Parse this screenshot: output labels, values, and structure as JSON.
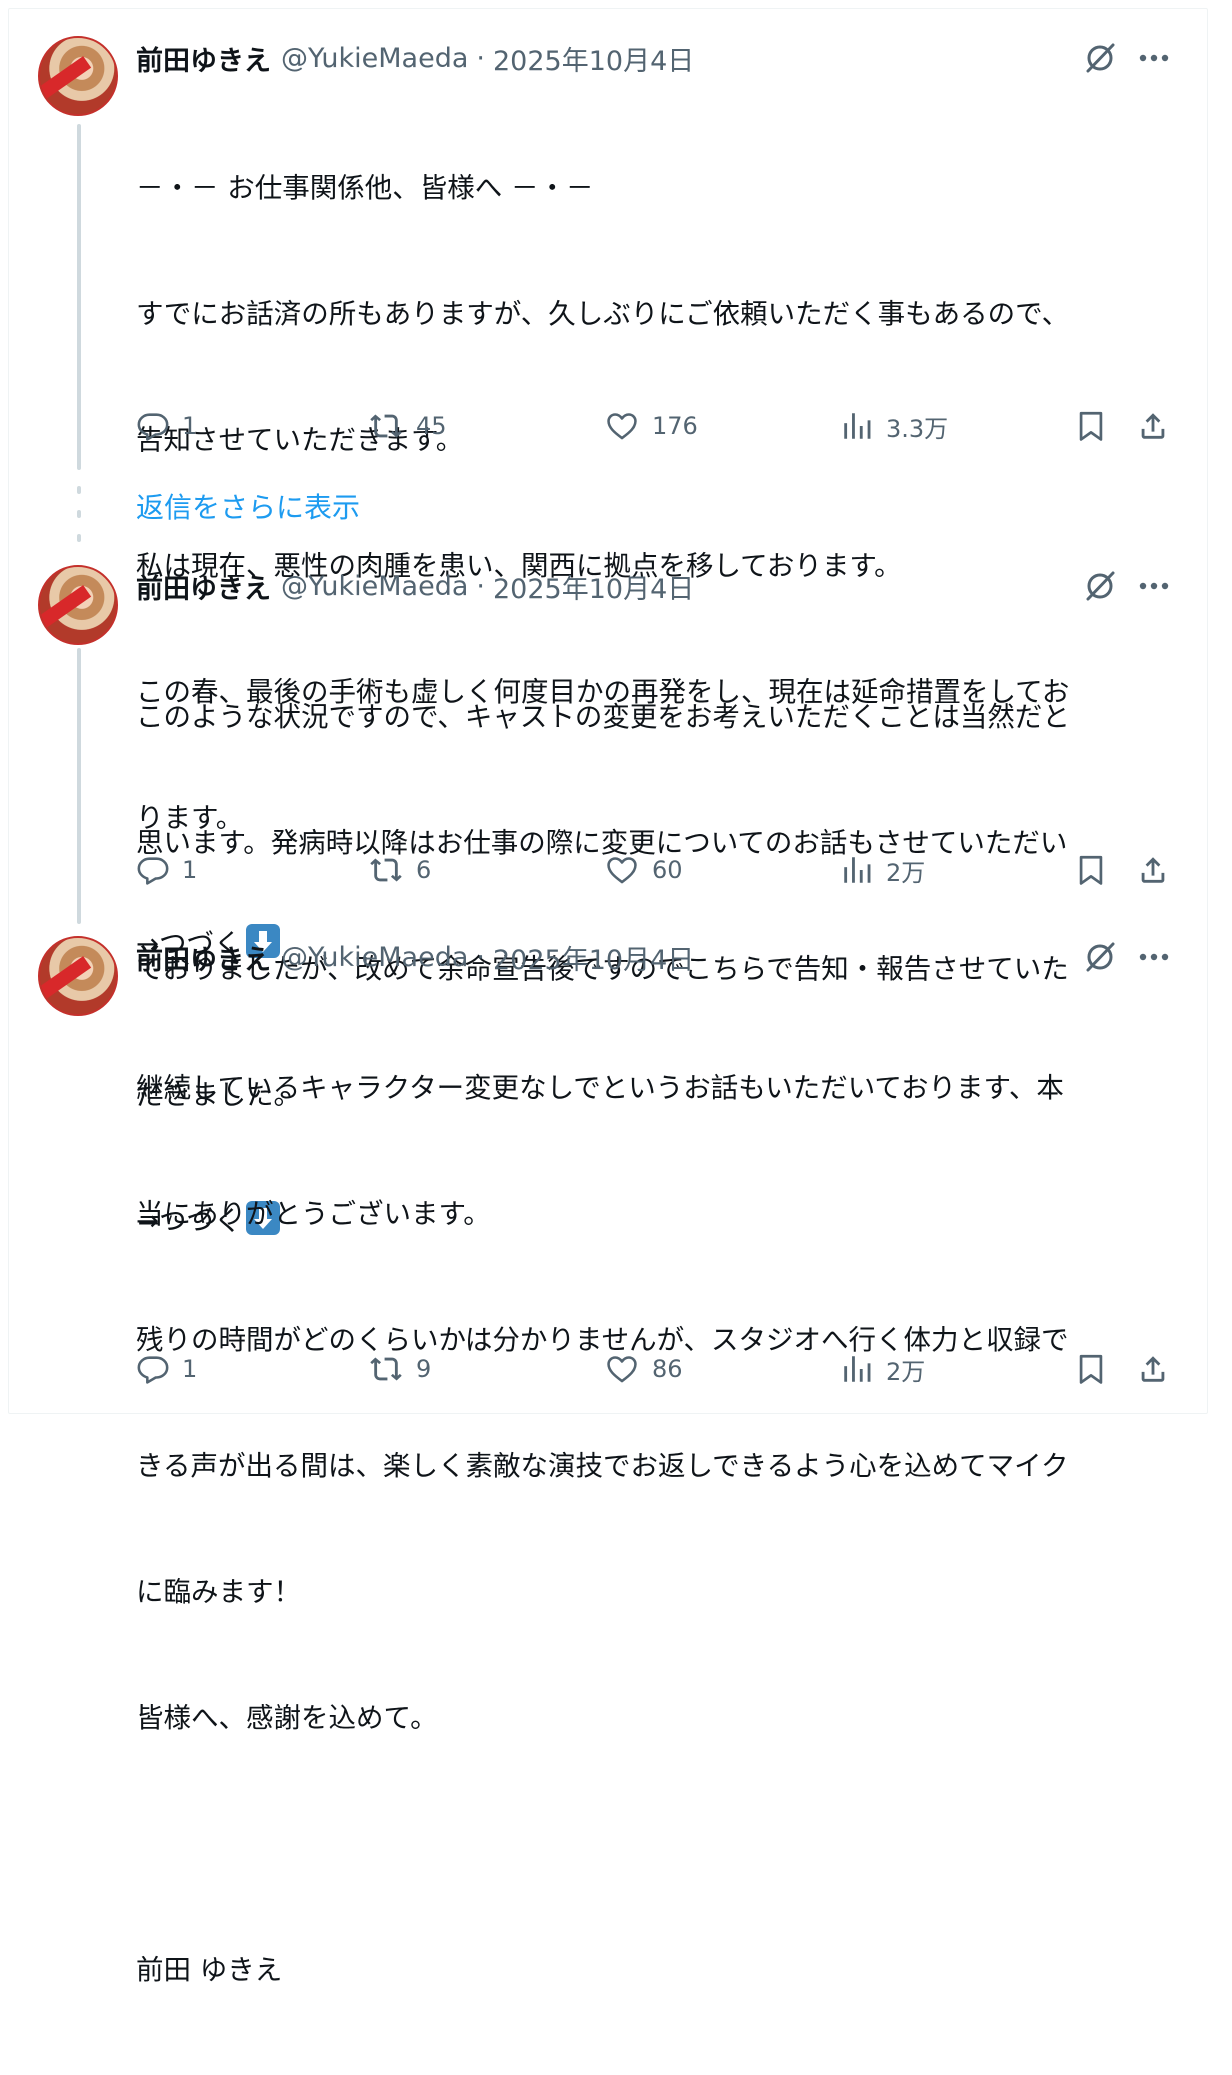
{
  "author": {
    "name": "前田ゆきえ",
    "handle": "@YukieMaeda",
    "separator": "·"
  },
  "show_more_replies": "返信をさらに表示",
  "tweets": [
    {
      "date": "2025年10月4日",
      "lines": [
        "－・－ お仕事関係他、皆様へ －・－",
        "すでにお話済の所もありますが、久しぶりにご依頼いただく事もあるので、",
        "告知させていただきます。",
        "私は現在、悪性の肉腫を患い、関西に拠点を移しております。",
        "この春、最後の手術も虚しく何度目かの再発をし、現在は延命措置をしてお",
        "ります。"
      ],
      "continue_text": "→つづく",
      "metrics": {
        "replies": "1",
        "reposts": "45",
        "likes": "176",
        "views": "3.3万"
      }
    },
    {
      "date": "2025年10月4日",
      "lines": [
        "このような状況ですので、キャストの変更をお考えいただくことは当然だと",
        "思います。発病時以降はお仕事の際に変更についてのお話もさせていただい",
        "ておりましたが、改めて余命宣告後ですのでこちらで告知・報告させていた",
        "だきました。"
      ],
      "continue_text": "→つづく",
      "metrics": {
        "replies": "1",
        "reposts": "6",
        "likes": "60",
        "views": "2万"
      }
    },
    {
      "date": "2025年10月4日",
      "lines": [
        "継続しているキャラクター変更なしでというお話もいただいております、本",
        "当にありがとうございます。",
        "残りの時間がどのくらいかは分かりませんが、スタジオへ行く体力と収録で",
        "きる声が出る間は、楽しく素敵な演技でお返しできるよう心を込めてマイク",
        "に臨みます！",
        "皆様へ、感謝を込めて。",
        "",
        "前田 ゆきえ"
      ],
      "continue_text": "",
      "metrics": {
        "replies": "1",
        "reposts": "9",
        "likes": "86",
        "views": "2万"
      }
    }
  ],
  "icons": {
    "avatar": "profile-photo",
    "grok": "grok-icon",
    "more": "more-icon",
    "reply": "reply-icon",
    "repost": "repost-icon",
    "like": "heart-icon",
    "views": "views-icon",
    "bookmark": "bookmark-icon",
    "share": "share-icon",
    "emoji": "down-arrow-emoji"
  },
  "colors": {
    "text": "#0f1419",
    "secondary": "#536471",
    "link": "#1d9bf0",
    "thread_line": "#cfd9de",
    "emoji_blue": "#3b88c3"
  }
}
